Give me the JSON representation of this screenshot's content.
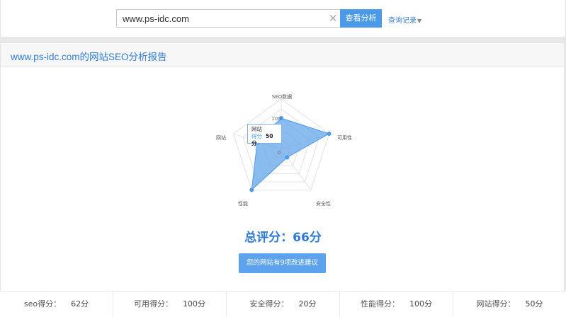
{
  "search": {
    "value": "www.ps-idc.com",
    "button_label": "查看分析",
    "history_label": "查询记录"
  },
  "panel": {
    "title": "www.ps-idc.com的网站SEO分析报告"
  },
  "chart_data": {
    "type": "radar",
    "axes": [
      "SEO数据",
      "可用性",
      "安全性",
      "性能",
      "网站"
    ],
    "series": [
      {
        "values": [
          62,
          100,
          20,
          100,
          50
        ]
      }
    ],
    "range": [
      0,
      100
    ],
    "tick_labels": [
      "100",
      "0"
    ],
    "grid": true,
    "colors": {
      "fill": "#6aa9ec",
      "stroke": "#4a9ae8",
      "grid": "#e3e3e3"
    }
  },
  "tooltip": {
    "category": "网站",
    "series_label": "得分",
    "value": "50分"
  },
  "summary": {
    "score_text": "总评分：66分",
    "suggest_label": "您的网站有9项改进建议"
  },
  "stats": [
    {
      "label": "seo得分：",
      "value": "62分"
    },
    {
      "label": "可用得分：",
      "value": "100分"
    },
    {
      "label": "安全得分：",
      "value": "20分"
    },
    {
      "label": "性能得分：",
      "value": "100分"
    },
    {
      "label": "网站得分：",
      "value": "50分"
    }
  ],
  "icons": {
    "clear": "close-icon",
    "history_caret": "chevron-down-icon"
  },
  "colors": {
    "accent": "#4a9ae8",
    "link": "#3d82d1",
    "title": "#2f7bd3"
  }
}
